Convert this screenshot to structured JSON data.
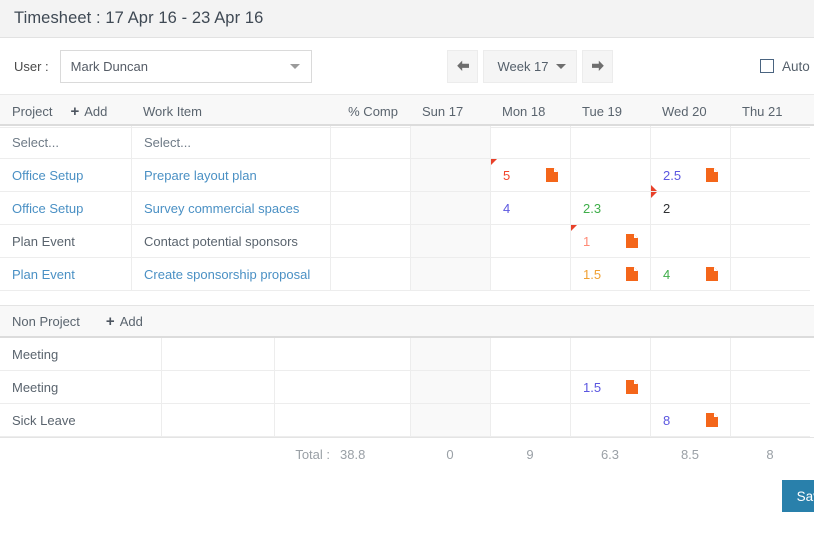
{
  "header": {
    "title": "Timesheet : 17 Apr 16 - 23 Apr 16"
  },
  "toolbar": {
    "user_label": "User :",
    "user_value": "Mark Duncan",
    "prev_week_icon": "arrow-left-icon",
    "next_week_icon": "arrow-right-icon",
    "week_value": "Week 17",
    "auto_label": "Auto",
    "auto_checked": false
  },
  "project_section": {
    "columns": {
      "project": "Project",
      "add": "Add",
      "work_item": "Work Item",
      "pct_complete": "% Comp"
    },
    "days": [
      "Sun 17",
      "Mon 18",
      "Tue 19",
      "Wed 20",
      "Thu 21"
    ],
    "placeholder_row": {
      "project": "Select...",
      "work_item": "Select..."
    },
    "rows": [
      {
        "project": "Office Setup",
        "work_item": "Prepare layout plan",
        "pct": "",
        "style": "link",
        "days": [
          {
            "value": "",
            "color": "",
            "note": false,
            "corner": ""
          },
          {
            "value": "5",
            "color": "#f2452b",
            "note": true,
            "corner": "tl"
          },
          {
            "value": "",
            "color": "",
            "note": false,
            "corner": ""
          },
          {
            "value": "2.5",
            "color": "#5b57e0",
            "note": true,
            "corner": "bl"
          },
          {
            "value": "",
            "color": "",
            "note": false,
            "corner": ""
          }
        ]
      },
      {
        "project": "Office Setup",
        "work_item": "Survey commercial spaces",
        "pct": "",
        "style": "link",
        "days": [
          {
            "value": "",
            "color": "",
            "note": false,
            "corner": ""
          },
          {
            "value": "4",
            "color": "#5b57e0",
            "note": false,
            "corner": ""
          },
          {
            "value": "2.3",
            "color": "#3fae4a",
            "note": false,
            "corner": ""
          },
          {
            "value": "2",
            "color": "#2f3134",
            "note": false,
            "corner": "tl"
          },
          {
            "value": "",
            "color": "",
            "note": false,
            "corner": ""
          }
        ]
      },
      {
        "project": "Plan Event",
        "work_item": "Contact potential sponsors",
        "pct": "",
        "style": "muted",
        "days": [
          {
            "value": "",
            "color": "",
            "note": false,
            "corner": ""
          },
          {
            "value": "",
            "color": "",
            "note": false,
            "corner": ""
          },
          {
            "value": "1",
            "color": "#ff8a75",
            "note": true,
            "corner": "tl"
          },
          {
            "value": "",
            "color": "",
            "note": false,
            "corner": ""
          },
          {
            "value": "",
            "color": "",
            "note": false,
            "corner": "tr-right"
          }
        ]
      },
      {
        "project": "Plan Event",
        "work_item": "Create sponsorship proposal",
        "pct": "",
        "style": "link",
        "days": [
          {
            "value": "",
            "color": "",
            "note": false,
            "corner": ""
          },
          {
            "value": "",
            "color": "",
            "note": false,
            "corner": ""
          },
          {
            "value": "1.5",
            "color": "#f0a033",
            "note": true,
            "corner": ""
          },
          {
            "value": "4",
            "color": "#3fae4a",
            "note": true,
            "corner": ""
          },
          {
            "value": "",
            "color": "",
            "note": false,
            "corner": ""
          }
        ]
      }
    ]
  },
  "non_project_section": {
    "title": "Non Project",
    "add": "Add",
    "rows": [
      {
        "name": "Meeting",
        "days": [
          {
            "value": "",
            "color": "",
            "note": false
          },
          {
            "value": "",
            "color": "",
            "note": false
          },
          {
            "value": "",
            "color": "",
            "note": false
          },
          {
            "value": "",
            "color": "",
            "note": false
          },
          {
            "value": "",
            "color": "",
            "note": false
          }
        ]
      },
      {
        "name": "Meeting",
        "days": [
          {
            "value": "",
            "color": "",
            "note": false
          },
          {
            "value": "",
            "color": "",
            "note": false
          },
          {
            "value": "1.5",
            "color": "#5b57e0",
            "note": true
          },
          {
            "value": "",
            "color": "",
            "note": false
          },
          {
            "value": "",
            "color": "",
            "note": false
          }
        ]
      },
      {
        "name": "Sick Leave",
        "days": [
          {
            "value": "",
            "color": "",
            "note": false
          },
          {
            "value": "",
            "color": "",
            "note": false
          },
          {
            "value": "",
            "color": "",
            "note": false
          },
          {
            "value": "8",
            "color": "#5b57e0",
            "note": true
          },
          {
            "value": "",
            "color": "",
            "note": false
          }
        ]
      }
    ]
  },
  "totals": {
    "label": "Total :",
    "grand": "38.8",
    "days": [
      "0",
      "9",
      "6.3",
      "8.5",
      "8"
    ]
  },
  "footer": {
    "save_label": "Save"
  },
  "colors": {
    "accent": "#2980ab",
    "link": "#4a90c4",
    "note_icon": "#f4661a",
    "corner_flag": "#e8412a"
  }
}
